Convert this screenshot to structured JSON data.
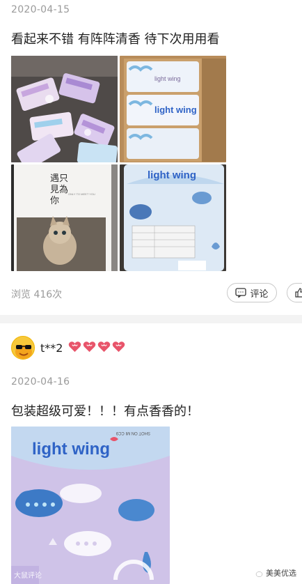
{
  "review1": {
    "date": "2020-04-15",
    "text": "看起来不错 有阵阵清香 待下次用用看",
    "views_label": "浏览 416次",
    "comment_button": "评论",
    "photo_brand": "light wing",
    "photo_card_text": [
      "遇见",
      "只为",
      "你"
    ],
    "photo_card_en": "ONLY TO MEET YOU"
  },
  "review2": {
    "user": "t**2",
    "hearts": 4,
    "date": "2020-04-16",
    "text": "包装超级可爱！！！有点香香的！",
    "photo_brand": "light wing",
    "photo_camera_text": "SHOT ON MI CC9 · AI TRIPLE CAMERA"
  },
  "watermark": {
    "left": "大鼠评论",
    "right": "美美优选"
  },
  "colors": {
    "meta_gray": "#9a9a9a",
    "divider": "#f3f3f3",
    "heart": "#e8546a",
    "brand_blue": "#2f63c6"
  }
}
